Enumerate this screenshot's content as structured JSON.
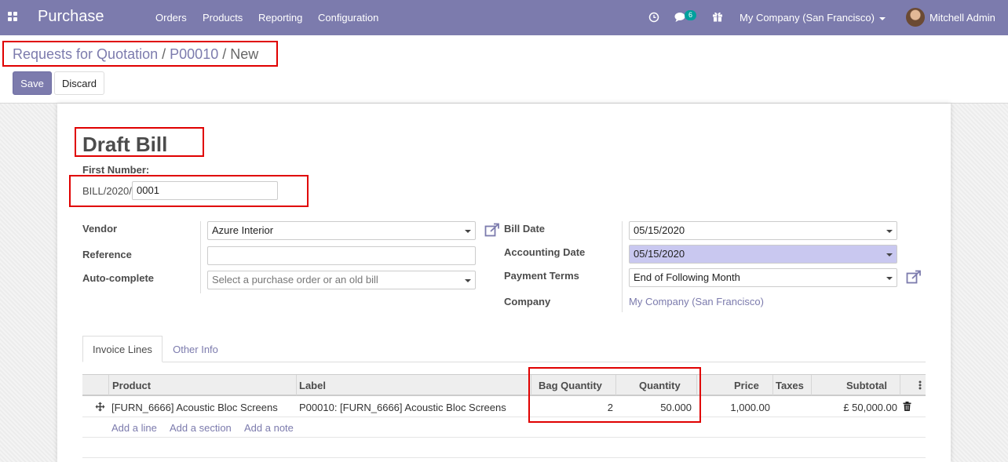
{
  "navbar": {
    "app_title": "Purchase",
    "menu": [
      "Orders",
      "Products",
      "Reporting",
      "Configuration"
    ],
    "messages_count": "6",
    "company": "My Company (San Francisco)",
    "user": "Mitchell Admin"
  },
  "breadcrumb": {
    "items": [
      "Requests for Quotation",
      "P00010",
      "New"
    ],
    "separator": "/"
  },
  "buttons": {
    "save": "Save",
    "discard": "Discard"
  },
  "form": {
    "title": "Draft Bill",
    "first_number_label": "First Number:",
    "prefix": "BILL/2020/",
    "number_value": "0001",
    "vendor_label": "Vendor",
    "vendor_value": "Azure Interior",
    "reference_label": "Reference",
    "reference_value": "",
    "autocomplete_label": "Auto-complete",
    "autocomplete_placeholder": "Select a purchase order or an old bill",
    "bill_date_label": "Bill Date",
    "bill_date_value": "05/15/2020",
    "accounting_date_label": "Accounting Date",
    "accounting_date_value": "05/15/2020",
    "payment_terms_label": "Payment Terms",
    "payment_terms_value": "End of Following Month",
    "company_label": "Company",
    "company_value": "My Company (San Francisco)"
  },
  "tabs": [
    "Invoice Lines",
    "Other Info"
  ],
  "table": {
    "columns": [
      "Product",
      "Label",
      "Bag Quantity",
      "Quantity",
      "Price",
      "Taxes",
      "Subtotal"
    ],
    "rows": [
      {
        "product": "[FURN_6666] Acoustic Bloc Screens",
        "label": "P00010: [FURN_6666] Acoustic Bloc Screens",
        "bag_quantity": "2",
        "quantity": "50.000",
        "price": "1,000.00",
        "taxes": "",
        "subtotal": "£ 50,000.00"
      }
    ],
    "add_line": "Add a line",
    "add_section": "Add a section",
    "add_note": "Add a note"
  },
  "colors": {
    "brand": "#7c7bad",
    "highlight": "#e00000",
    "badge": "#00a09d"
  }
}
